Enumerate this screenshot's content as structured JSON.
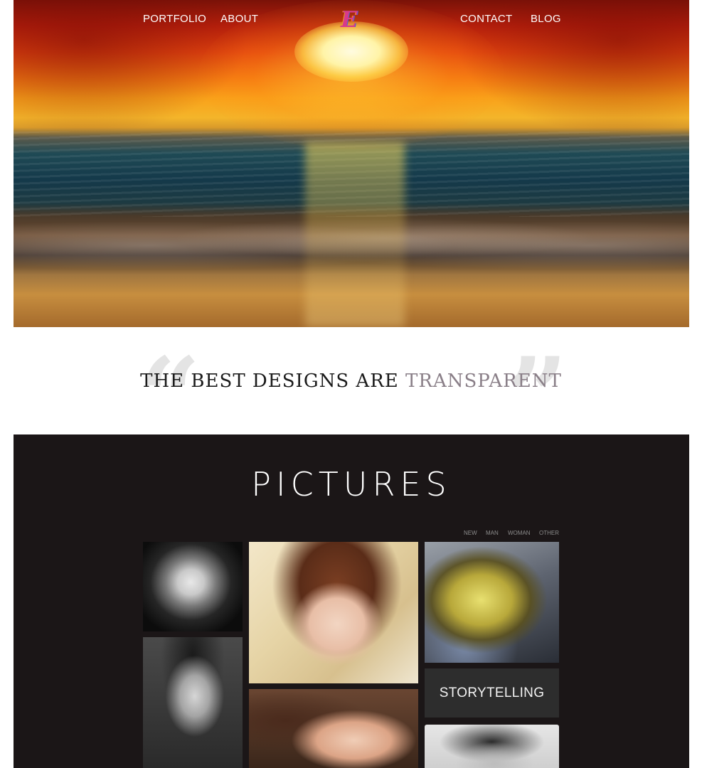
{
  "nav": {
    "portfolio": "PORTFOLIO",
    "about": "ABOUT",
    "logo": "E",
    "contact": "CONTACT",
    "blog": "BLOG"
  },
  "quote": {
    "open_mark": "“",
    "close_mark": "”",
    "text_main": "THE BEST DESIGNS ARE ",
    "text_accent": "TRANSPARENT"
  },
  "gallery": {
    "title": "PICTURES",
    "filters": [
      "NEW",
      "MAN",
      "WOMAN",
      "OTHER"
    ],
    "storytelling_label": "STORYTELLING"
  },
  "colors": {
    "accent_text": "#8a7f88",
    "gallery_background": "#1b1617",
    "label_tile": "#2d2d2d"
  }
}
